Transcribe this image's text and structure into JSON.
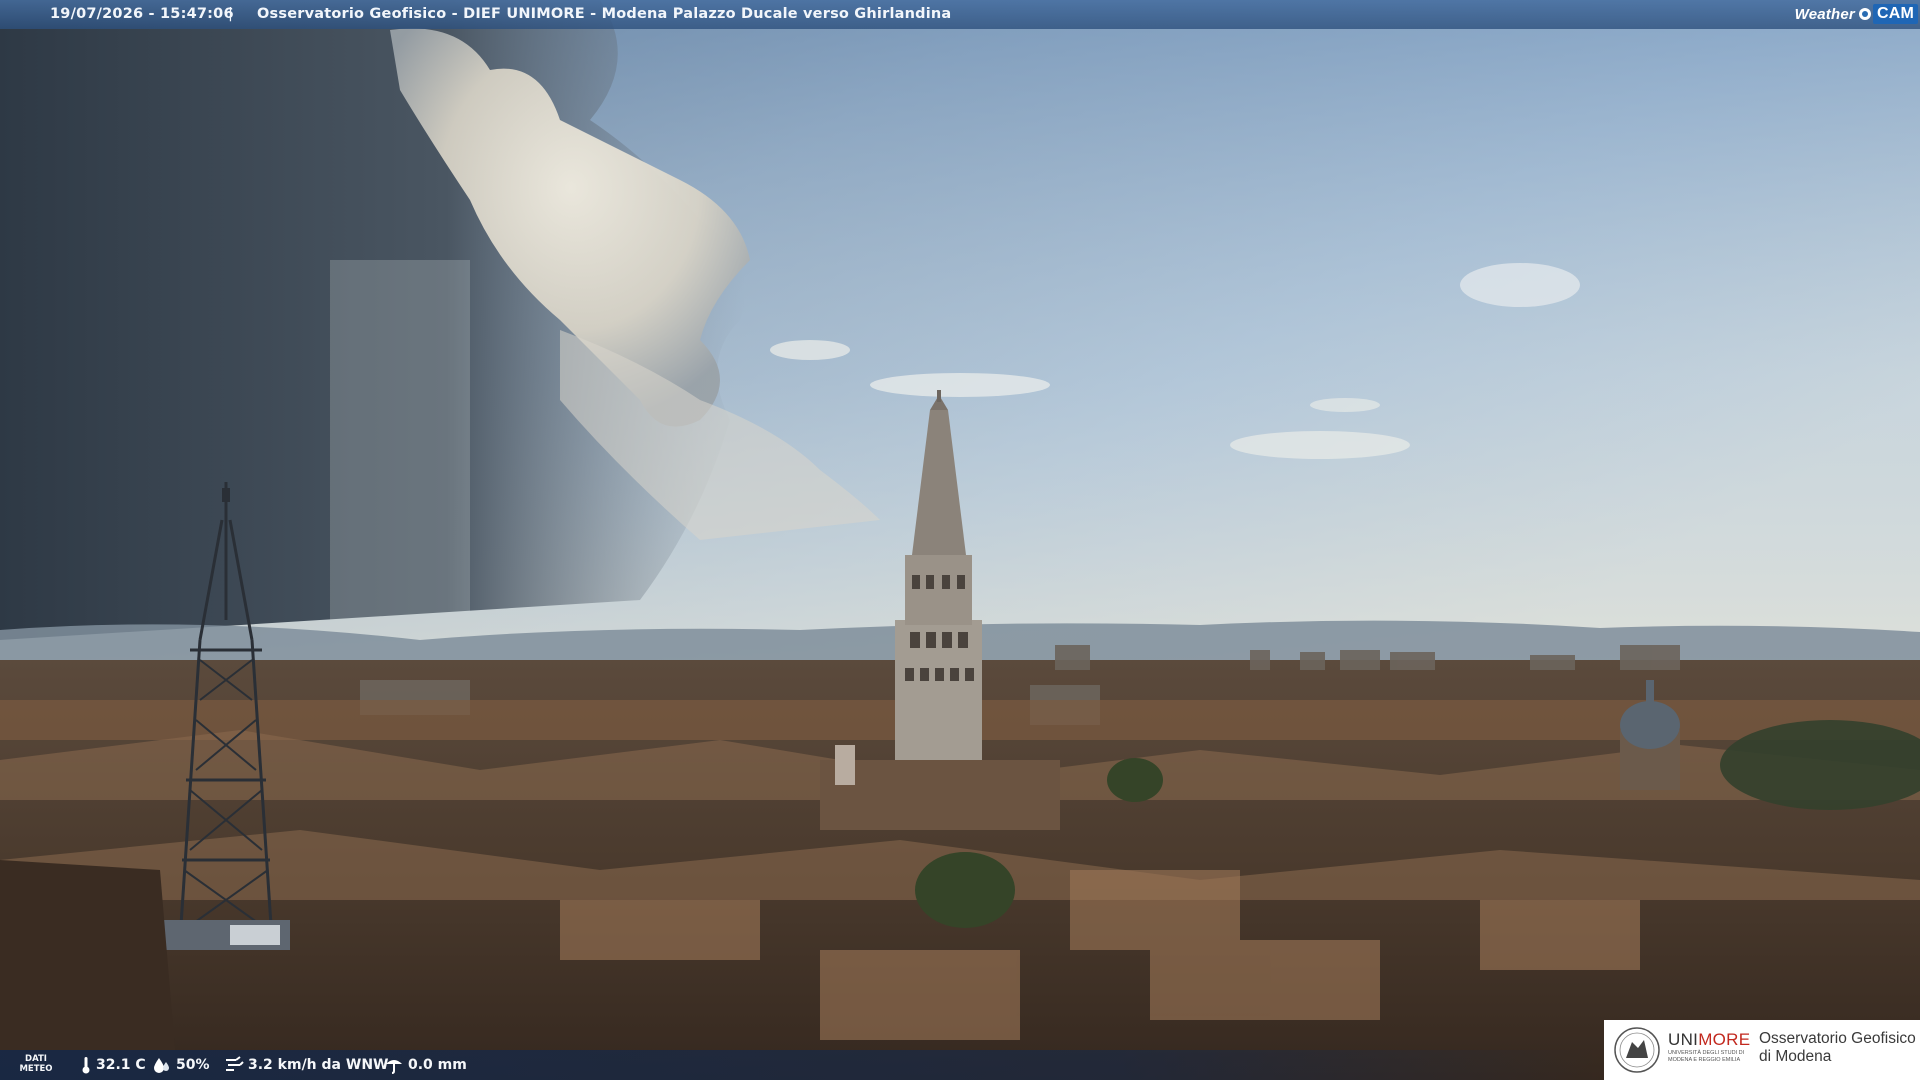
{
  "header": {
    "timestamp": "19/07/2026 - 15:47:06",
    "separator": "|",
    "title": "Osservatorio Geofisico - DIEF UNIMORE - Modena Palazzo Ducale verso Ghirlandina",
    "brand_weather": "Weather",
    "brand_cam": "CAM"
  },
  "weather": {
    "label_line1": "DATI",
    "label_line2": "METEO",
    "temperature": "32.1 C",
    "humidity": "50%",
    "wind": "3.2 km/h da WNW",
    "rain": "0.0 mm",
    "icons": [
      "thermometer-icon",
      "humidity-drop-icon",
      "wind-icon",
      "rain-gauge-icon"
    ]
  },
  "logo": {
    "uni_part1": "UNI",
    "uni_part2": "MORE",
    "small_line1": "UNIVERSITÀ DEGLI STUDI DI",
    "small_line2": "MODENA E REGGIO EMILIA",
    "name_line1": "Osservatorio Geofisico",
    "name_line2": "di Modena"
  },
  "colors": {
    "bar": "#3d6aa0",
    "unimore_red": "#c2281e",
    "brand_blue": "#1f66b5"
  }
}
